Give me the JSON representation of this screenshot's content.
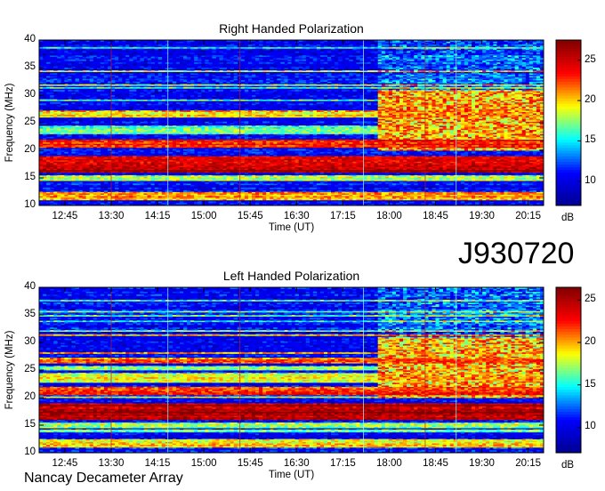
{
  "observation_id": "J930720",
  "footer": "Nancay Decameter Array",
  "colors": {
    "colormap": [
      "#00008f",
      "#0000ff",
      "#00ffff",
      "#ffff00",
      "#ff0000",
      "#800000"
    ]
  },
  "chart_data": [
    {
      "type": "heatmap",
      "title": "Right Handed Polarization",
      "xlabel": "Time (UT)",
      "ylabel": "Frequency (MHz)",
      "x_ticks": [
        "12:45",
        "13:30",
        "14:15",
        "15:00",
        "15:45",
        "16:30",
        "17:15",
        "18:00",
        "18:45",
        "19:30",
        "20:15"
      ],
      "y_ticks": [
        10,
        15,
        20,
        25,
        30,
        35,
        40
      ],
      "ylim": [
        10,
        40
      ],
      "xlim": [
        "12:20",
        "20:30"
      ],
      "colorbar": {
        "label": "dB",
        "ticks": [
          10,
          15,
          20,
          25
        ],
        "range": [
          7,
          27.5
        ]
      },
      "bright_bands_mhz": [
        {
          "lo": 16,
          "hi": 19,
          "level": 26
        },
        {
          "lo": 20.5,
          "hi": 22,
          "level": 24
        },
        {
          "lo": 11,
          "hi": 12.5,
          "level": 22
        },
        {
          "lo": 26,
          "hi": 27.3,
          "level": 21
        },
        {
          "lo": 23,
          "hi": 24.5,
          "level": 18
        },
        {
          "lo": 14.5,
          "hi": 15.5,
          "level": 19
        }
      ],
      "late_activity": {
        "start": "17:50",
        "lo": 20,
        "hi": 31,
        "level": 24
      }
    },
    {
      "type": "heatmap",
      "title": "Left Handed Polarization",
      "xlabel": "Time (UT)",
      "ylabel": "Frequency (MHz)",
      "x_ticks": [
        "12:45",
        "13:30",
        "14:15",
        "15:00",
        "15:45",
        "16:30",
        "17:15",
        "18:00",
        "18:45",
        "19:30",
        "20:15"
      ],
      "y_ticks": [
        10,
        15,
        20,
        25,
        30,
        35,
        40
      ],
      "ylim": [
        10,
        40
      ],
      "xlim": [
        "12:20",
        "20:30"
      ],
      "colorbar": {
        "label": "dB",
        "ticks": [
          10,
          15,
          20,
          25
        ],
        "range": [
          7,
          26.5
        ]
      },
      "bright_bands_mhz": [
        {
          "lo": 16,
          "hi": 19,
          "level": 25.5
        },
        {
          "lo": 20.5,
          "hi": 22,
          "level": 23
        },
        {
          "lo": 11,
          "hi": 12.5,
          "level": 20
        },
        {
          "lo": 26.2,
          "hi": 27.3,
          "level": 22
        },
        {
          "lo": 23,
          "hi": 24.5,
          "level": 19
        },
        {
          "lo": 14.5,
          "hi": 15.5,
          "level": 18
        }
      ],
      "late_activity": {
        "start": "17:50",
        "lo": 20,
        "hi": 31,
        "level": 23
      }
    }
  ]
}
